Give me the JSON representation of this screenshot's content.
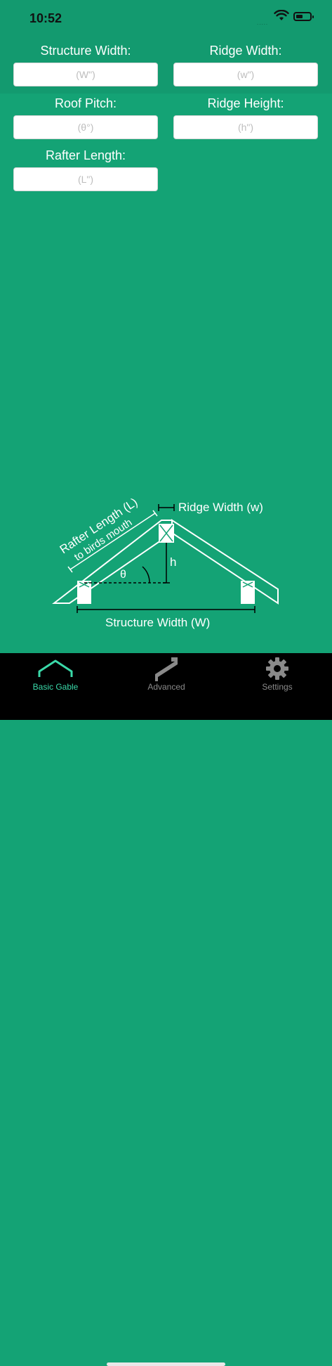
{
  "status": {
    "time": "10:52",
    "signal": "....."
  },
  "form": {
    "structure_width": {
      "label": "Structure Width:",
      "placeholder": "(W\")"
    },
    "ridge_width": {
      "label": "Ridge Width:",
      "placeholder": "(w\")"
    },
    "roof_pitch": {
      "label": "Roof Pitch:",
      "placeholder": "(θ°)"
    },
    "ridge_height": {
      "label": "Ridge Height:",
      "placeholder": "(h\")"
    },
    "rafter_length": {
      "label": "Rafter Length:",
      "placeholder": "(L\")"
    }
  },
  "diagram": {
    "rafter_label": "Rafter Length (L)",
    "rafter_sublabel": "to birds mouth",
    "ridge_label": "Ridge Width (w)",
    "height_label": "h",
    "angle_label": "θ",
    "width_label": "Structure Width (W)"
  },
  "tabs": [
    {
      "label": "Basic Gable",
      "icon": "gable-roof-icon",
      "active": true
    },
    {
      "label": "Advanced",
      "icon": "rafter-icon",
      "active": false
    },
    {
      "label": "Settings",
      "icon": "gear-icon",
      "active": false
    }
  ],
  "colors": {
    "background": "#14a375",
    "header_band": "#139a6f",
    "accent": "#3ad9a9",
    "tabbar": "#000000"
  }
}
